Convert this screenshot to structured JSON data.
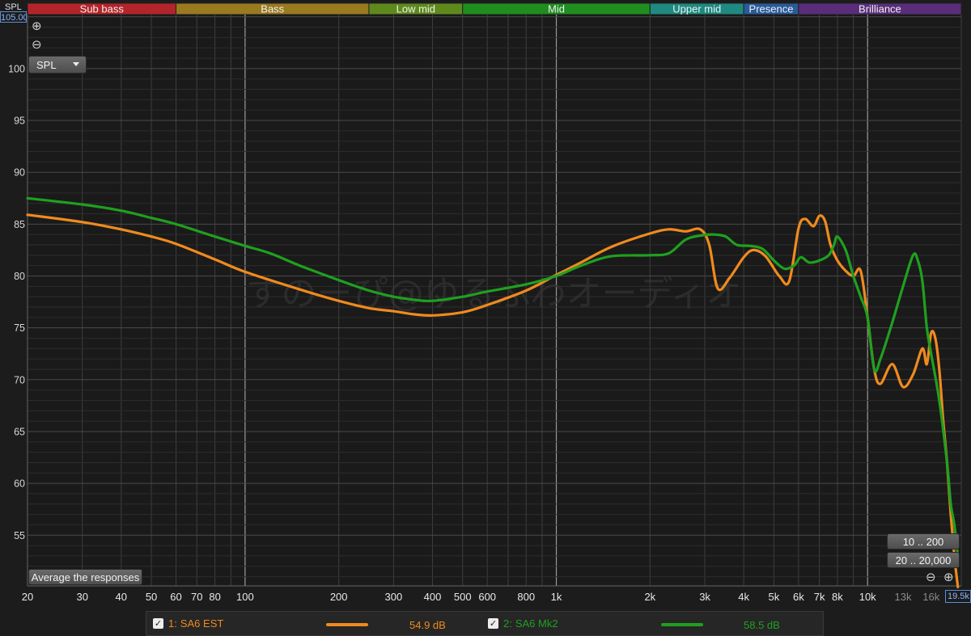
{
  "bands": [
    {
      "label": "Sub bass",
      "from": 20,
      "to": 60,
      "color": "#b3242b"
    },
    {
      "label": "Bass",
      "from": 60,
      "to": 250,
      "color": "#9a7a1e"
    },
    {
      "label": "Low mid",
      "from": 250,
      "to": 500,
      "color": "#5e8a1c"
    },
    {
      "label": "Mid",
      "from": 500,
      "to": 2000,
      "color": "#1f8e1f"
    },
    {
      "label": "Upper mid",
      "from": 2000,
      "to": 4000,
      "color": "#1e8a80"
    },
    {
      "label": "Presence",
      "from": 4000,
      "to": 6000,
      "color": "#2a5a9a"
    },
    {
      "label": "Brilliance",
      "from": 6000,
      "to": 20000,
      "color": "#5a2d7a"
    }
  ],
  "y_axis": {
    "title": "SPL",
    "top_value": "105.00"
  },
  "x_axis": {
    "right_value": "19.5k"
  },
  "controls": {
    "spl_dropdown": "SPL",
    "average_button": "Average the responses",
    "range1": "10 .. 200",
    "range2": "20 .. 20,000",
    "zoom_in_icon": "zoom-in-icon",
    "zoom_out_icon": "zoom-out-icon"
  },
  "watermark": "すのーぴ@ゆるふわオーディオ",
  "legend": {
    "items": [
      {
        "index": "1:",
        "name": "SA6 EST",
        "value": "54.9 dB",
        "color": "#f08a1e",
        "checked": true
      },
      {
        "index": "2:",
        "name": "SA6 Mk2",
        "value": "58.5 dB",
        "color": "#1fa01f",
        "checked": true
      }
    ]
  },
  "chart_data": {
    "type": "line",
    "x_scale": "log",
    "xlim": [
      20,
      20000
    ],
    "ylim": [
      50,
      105
    ],
    "ylabel": "SPL",
    "grid": true,
    "x_ticks": [
      20,
      30,
      40,
      50,
      60,
      70,
      80,
      100,
      200,
      300,
      400,
      500,
      600,
      800,
      1000,
      2000,
      3000,
      4000,
      5000,
      6000,
      7000,
      8000,
      10000,
      13000,
      16000
    ],
    "x_tick_labels": [
      "20",
      "30",
      "40",
      "50",
      "60",
      "70",
      "80",
      "100",
      "200",
      "300",
      "400",
      "500",
      "600",
      "800",
      "1k",
      "2k",
      "3k",
      "4k",
      "5k",
      "6k",
      "7k",
      "8k",
      "10k",
      "13k",
      "16k"
    ],
    "y_ticks": [
      55,
      60,
      65,
      70,
      75,
      80,
      85,
      90,
      95,
      100
    ],
    "series": [
      {
        "name": "SA6 EST",
        "color": "#f08a1e",
        "x": [
          20,
          30,
          40,
          50,
          60,
          80,
          100,
          150,
          200,
          250,
          300,
          350,
          400,
          500,
          600,
          800,
          1000,
          1200,
          1500,
          2000,
          2300,
          2600,
          2900,
          3100,
          3300,
          3600,
          4000,
          4300,
          4700,
          5200,
          5600,
          6000,
          6300,
          6700,
          7000,
          7300,
          7600,
          8000,
          8500,
          9000,
          9500,
          10000,
          10500,
          11000,
          12000,
          13000,
          14000,
          15000,
          15500,
          16000,
          16500,
          17000,
          17500,
          18000,
          18500,
          19000,
          19500
        ],
        "y": [
          85.9,
          85.2,
          84.5,
          83.8,
          83.1,
          81.6,
          80.4,
          78.7,
          77.6,
          76.9,
          76.6,
          76.3,
          76.2,
          76.5,
          77.2,
          78.6,
          80.1,
          81.3,
          82.8,
          84.1,
          84.5,
          84.3,
          84.5,
          83.0,
          78.8,
          79.8,
          81.8,
          82.5,
          81.9,
          80.0,
          79.5,
          84.6,
          85.5,
          84.8,
          85.8,
          85.3,
          83.0,
          81.5,
          80.5,
          80.0,
          80.5,
          76.0,
          71.0,
          69.6,
          71.5,
          69.3,
          70.5,
          73.0,
          71.5,
          74.5,
          74.0,
          71.0,
          66.0,
          62.0,
          57.0,
          53.0,
          50.0
        ]
      },
      {
        "name": "SA6 Mk2",
        "color": "#1fa01f",
        "x": [
          20,
          30,
          40,
          50,
          60,
          80,
          100,
          120,
          150,
          200,
          250,
          300,
          350,
          400,
          500,
          600,
          800,
          1000,
          1200,
          1500,
          2000,
          2300,
          2600,
          2900,
          3200,
          3500,
          3800,
          4200,
          4600,
          5000,
          5400,
          5800,
          6100,
          6500,
          7000,
          7500,
          7800,
          8000,
          8500,
          9000,
          9500,
          10000,
          10500,
          11000,
          12000,
          13000,
          14000,
          14500,
          15000,
          15500,
          16000,
          17000,
          18000,
          18500,
          19000,
          19500
        ],
        "y": [
          87.5,
          86.9,
          86.3,
          85.6,
          85.0,
          83.8,
          82.9,
          82.2,
          81.0,
          79.6,
          78.6,
          78.0,
          77.7,
          77.6,
          78.0,
          78.5,
          79.2,
          80.0,
          81.0,
          81.9,
          82.0,
          82.2,
          83.5,
          83.9,
          84.0,
          83.8,
          83.0,
          82.9,
          82.6,
          81.5,
          80.7,
          81.0,
          81.8,
          81.3,
          81.5,
          82.0,
          83.0,
          83.8,
          82.5,
          80.0,
          78.0,
          76.0,
          71.0,
          72.0,
          75.5,
          79.0,
          82.0,
          81.5,
          79.5,
          75.0,
          72.5,
          68.0,
          62.0,
          58.0,
          56.0,
          53.0
        ]
      }
    ]
  }
}
